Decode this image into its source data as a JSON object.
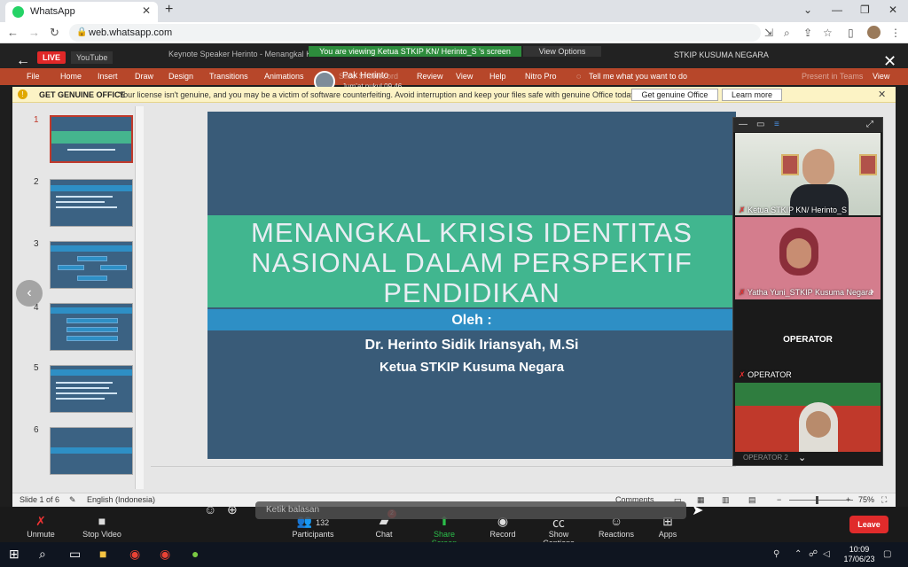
{
  "browser": {
    "tab_title": "WhatsApp",
    "url": "web.whatsapp.com"
  },
  "zoom_header": {
    "live_badge": "LIVE",
    "youtube_label": "YouTube",
    "ppt_title": "Keynote Speaker Herinto - Menangkal K",
    "viewing_banner": "You are viewing Ketua STKIP KN/ Herinto_S 's screen",
    "view_options": "View Options",
    "org_label": "STKIP KUSUMA NEGARA"
  },
  "ppt_ribbon": {
    "tabs": [
      "File",
      "Home",
      "Insert",
      "Draw",
      "Design",
      "Transitions",
      "Animations",
      "Slide Show",
      "Record",
      "Review",
      "View",
      "Help",
      "Nitro Pro"
    ],
    "tell_me": "Tell me what you want to do",
    "present_teams": "Present in Teams",
    "view_short": "View"
  },
  "speaker": {
    "name": "Pak Herinto",
    "subtitle": "Jum’at pukul 09.46"
  },
  "notice": {
    "heading": "GET GENUINE OFFICE",
    "message": "Your license isn't genuine, and you may be a victim of software counterfeiting. Avoid interruption and keep your files safe with genuine Office today.",
    "button_genuine": "Get genuine Office",
    "button_learn": "Learn more"
  },
  "thumbnails": [
    {
      "num": "1"
    },
    {
      "num": "2"
    },
    {
      "num": "3"
    },
    {
      "num": "4"
    },
    {
      "num": "5"
    },
    {
      "num": "6"
    }
  ],
  "slide": {
    "title_line1": "MENANGKAL KRISIS IDENTITAS",
    "title_line2": "NASIONAL DALAM PERSPEKTIF",
    "title_line3": "PENDIDIKAN",
    "oleh": "Oleh :",
    "author": "Dr. Herinto Sidik Iriansyah, M.Si",
    "position": "Ketua STKIP Kusuma Negara"
  },
  "participants_gallery": [
    {
      "label": "Ketua STKIP KN/ Herinto_S"
    },
    {
      "label": "Yatha Yuni_STKIP Kusuma Negara"
    },
    {
      "label": "OPERATOR",
      "big": "OPERATOR"
    },
    {
      "label": "OPERATOR 2"
    }
  ],
  "ppt_status": {
    "slide_counter": "Slide 1 of 6",
    "language": "English (Indonesia)",
    "comments": "Comments",
    "zoom": "75%"
  },
  "message_box": {
    "placeholder": "Ketik balasan"
  },
  "zoom_toolbar": {
    "unmute": "Unmute",
    "stop_video": "Stop Video",
    "participants": "Participants",
    "participant_count": "132",
    "chat": "Chat",
    "chat_badge": "2",
    "share_screen": "Share Screen",
    "record": "Record",
    "show_captions": "Show Captions",
    "reactions": "Reactions",
    "apps": "Apps",
    "leave": "Leave"
  },
  "taskbar": {
    "time": "10:09",
    "date": "17/06/23"
  },
  "colors": {
    "slide_bg": "#395b78",
    "slide_green_band": "#41b68f",
    "slide_blue_band": "#2e8fc5",
    "ppt_ribbon": "#b7472a",
    "leave_red": "#e02b2b",
    "share_green": "#2bbf4a"
  }
}
